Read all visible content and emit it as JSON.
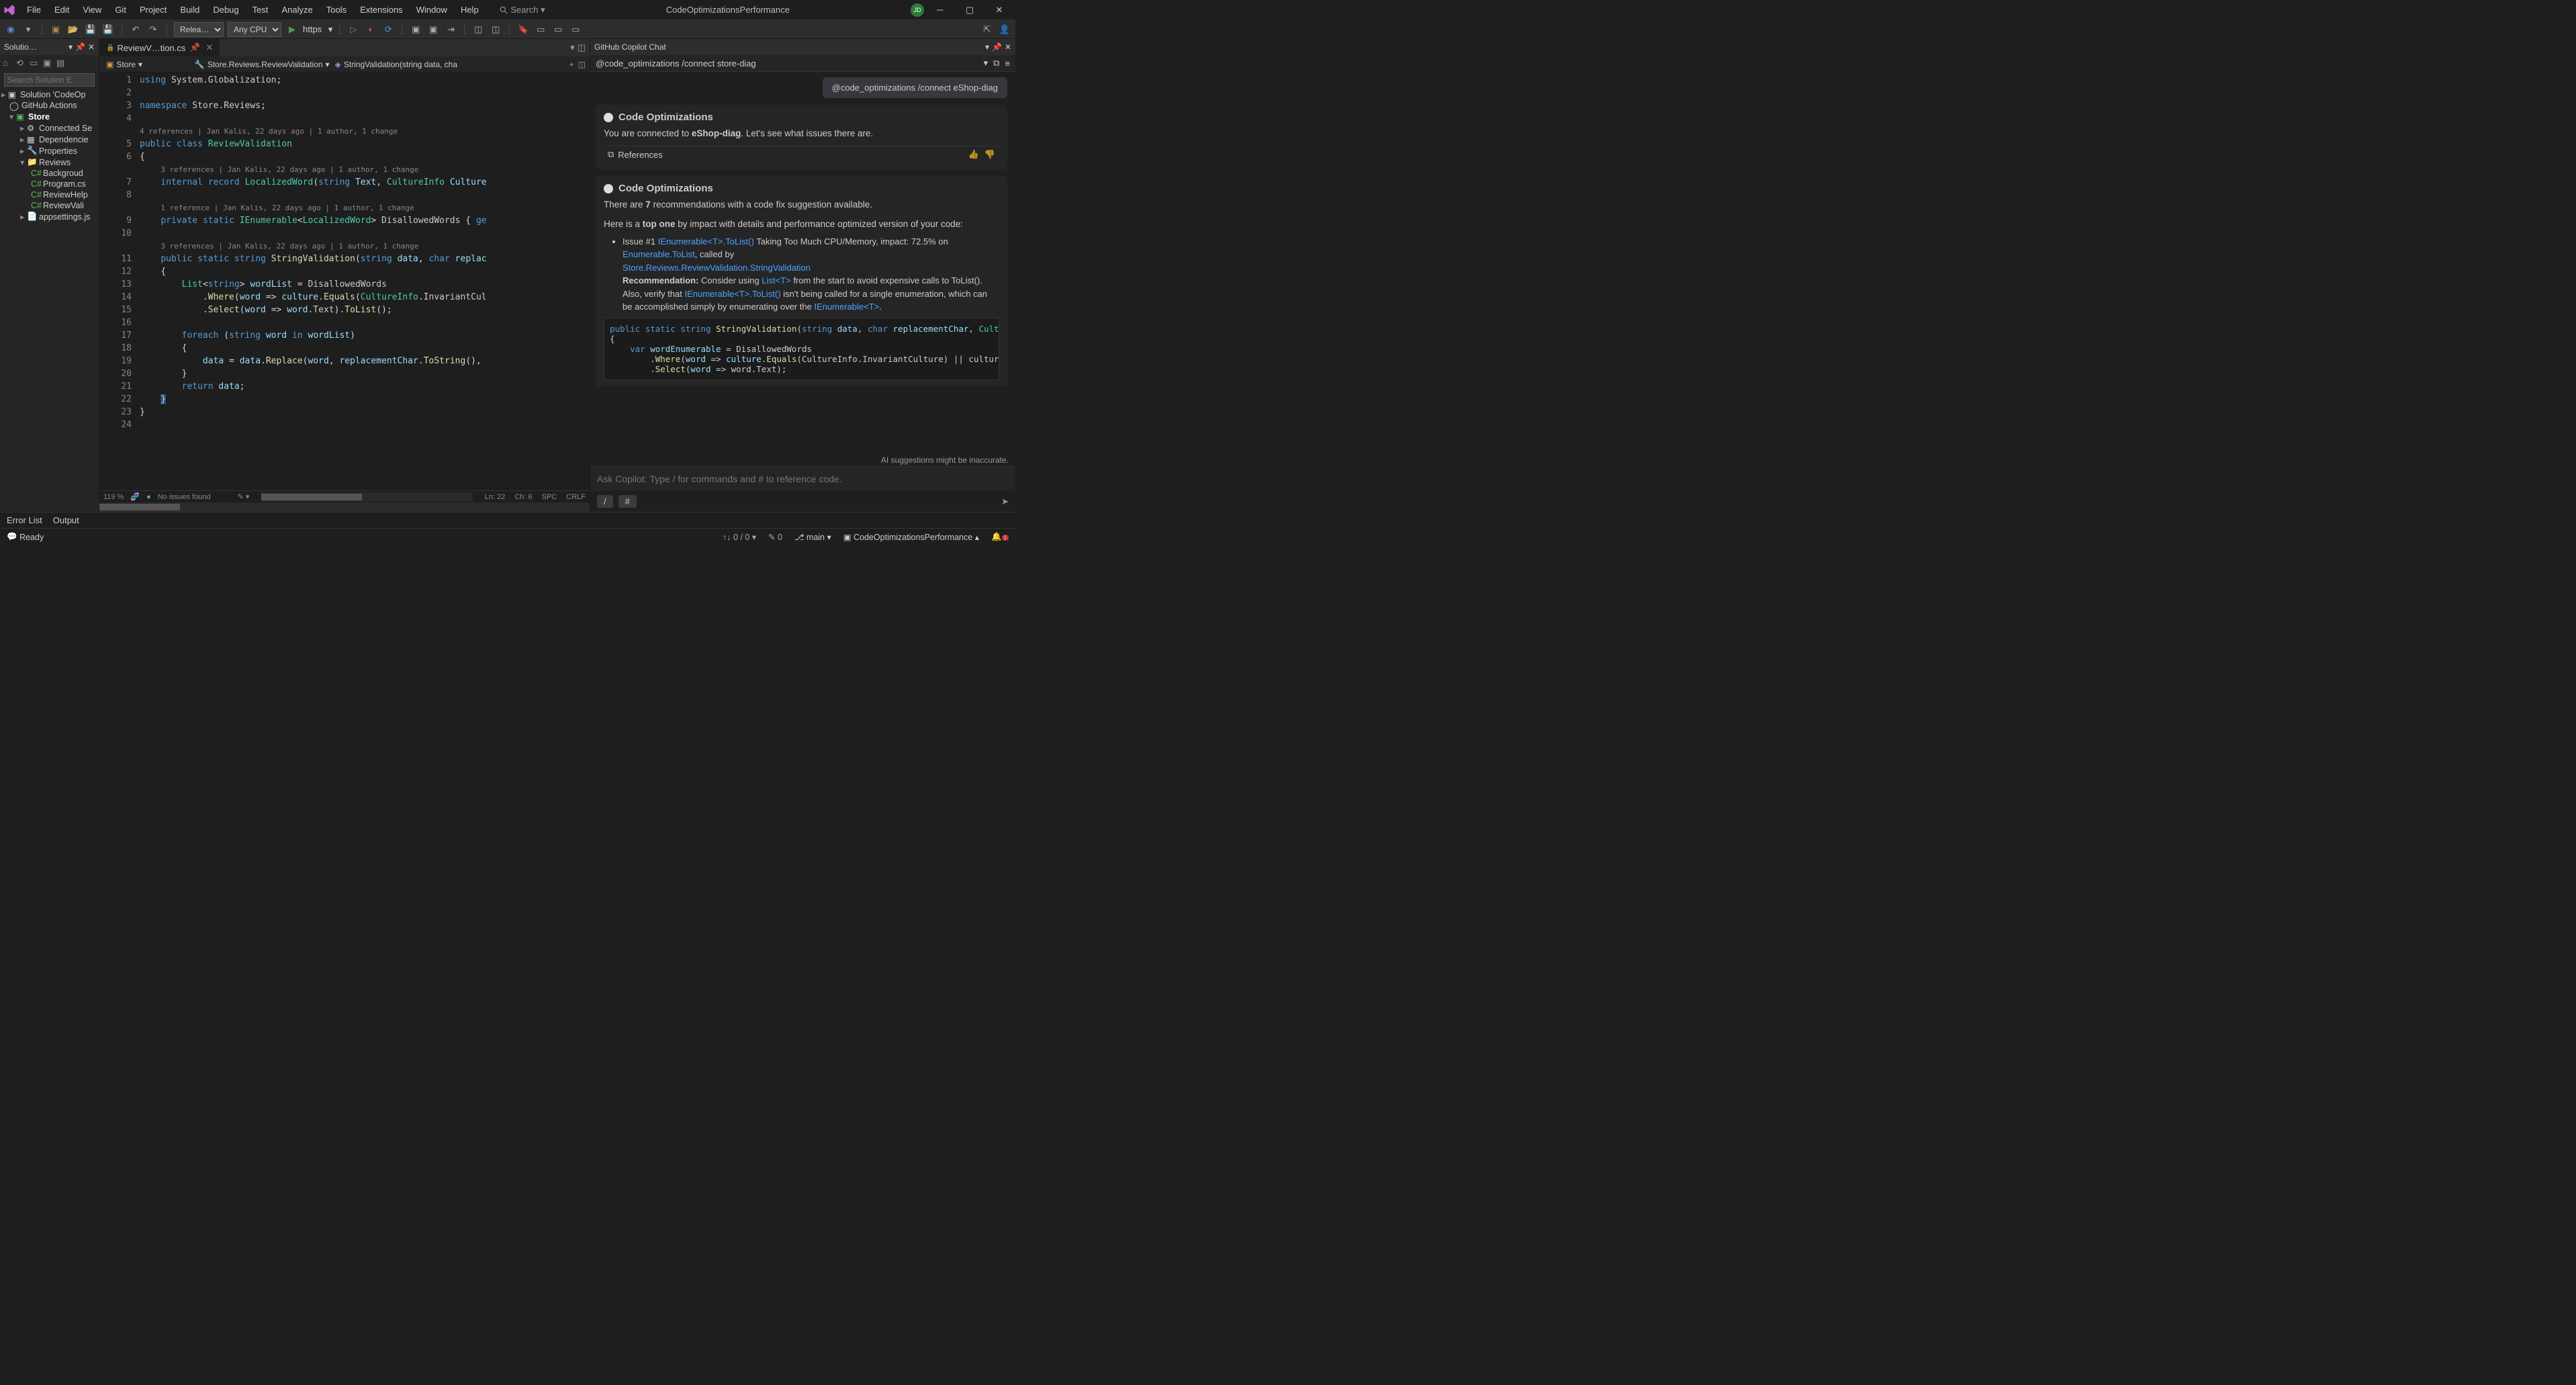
{
  "window": {
    "title": "CodeOptimizationsPerformance",
    "avatar": "JD"
  },
  "menu": [
    "File",
    "Edit",
    "View",
    "Git",
    "Project",
    "Build",
    "Debug",
    "Test",
    "Analyze",
    "Tools",
    "Extensions",
    "Window",
    "Help"
  ],
  "search_placeholder": "Search",
  "toolbar": {
    "config": "Relea…",
    "platform": "Any CPU",
    "launch": "https"
  },
  "solution": {
    "panel_title": "Solutio…",
    "search_placeholder": "Search Solution E",
    "root": "Solution 'CodeOp",
    "gha": "GitHub Actions",
    "project": "Store",
    "items": [
      "Connected Se",
      "Dependencie",
      "Properties",
      "Reviews"
    ],
    "reviews_children": [
      "Backgroud",
      "Program.cs",
      "ReviewHelp",
      "ReviewVali"
    ],
    "last": "appsettings.js"
  },
  "tab": {
    "name": "ReviewV…tion.cs"
  },
  "breadcrumb": {
    "b1": "Store",
    "b2": "Store.Reviews.ReviewValidation",
    "b3": "StringValidation(string data, cha"
  },
  "codelens": {
    "cl1": "4 references | Jan Kalis, 22 days ago | 1 author, 1 change",
    "cl2": "3 references | Jan Kalis, 22 days ago | 1 author, 1 change",
    "cl3": "1 reference | Jan Kalis, 22 days ago | 1 author, 1 change",
    "cl4": "3 references | Jan Kalis, 22 days ago | 1 author, 1 change"
  },
  "editor_status": {
    "zoom": "119 %",
    "issues": "No issues found",
    "ln": "Ln: 22",
    "ch": "Ch: 6",
    "spc": "SPC",
    "crlf": "CRLF"
  },
  "copilot": {
    "panel_title": "GitHub Copilot Chat",
    "top_input": "@code_optimizations /connect store-diag",
    "user_msg": "@code_optimizations /connect eShop-diag",
    "card1_title": "Code Optimizations",
    "card1_text_a": "You are connected to ",
    "card1_text_b": "eShop-diag",
    "card1_text_c": ". Let's see what issues there are.",
    "references": "References",
    "card2_title": "Code Optimizations",
    "rec_a": "There are ",
    "rec_b": "7",
    "rec_c": " recommendations with a code fix suggestion available.",
    "topone_a": "Here is a ",
    "topone_b": "top one",
    "topone_c": " by impact with details and performance optimized version of your code:",
    "issue_label": "Issue #1 ",
    "issue_link1": "IEnumerable<T>.ToList()",
    "issue_text1": " Taking Too Much CPU/Memory, impact: 72.5% on ",
    "issue_link2": "Enumerable.ToList",
    "issue_text2": ", called by ",
    "issue_link3": "Store.Reviews.ReviewValidation.StringValidation",
    "rec_label": "Recommendation: ",
    "rec_text1": "Consider using ",
    "rec_link1": "List<T>",
    "rec_text2": " from the start to avoid expensive calls to ToList(). Also, verify that ",
    "rec_link2": "IEnumerable<T>.ToList()",
    "rec_text3": " isn't being called for a single enumeration, which can be accomplished simply by enumerating over the ",
    "rec_link3": "IEnumerable<T>",
    "disclaimer": "AI suggestions might be inaccurate.",
    "ask_placeholder": "Ask Copilot: Type / for commands and # to reference code.",
    "cmd_slash": "/",
    "cmd_hash": "#"
  },
  "bottom_tabs": [
    "Error List",
    "Output"
  ],
  "status": {
    "ready": "Ready",
    "updown": "0 / 0",
    "pending": "0",
    "branch": "main",
    "project": "CodeOptimizationsPerformance"
  }
}
